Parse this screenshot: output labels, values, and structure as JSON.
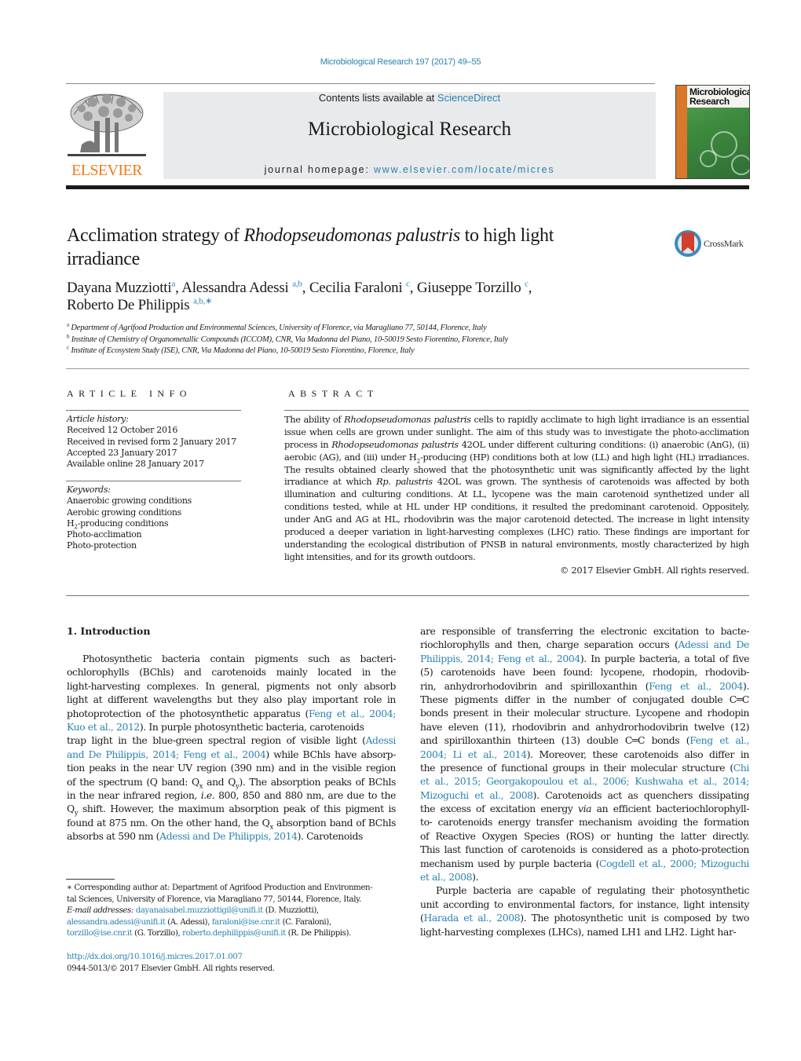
{
  "header": {
    "citation": "Microbiological Research 197 (2017) 49–55",
    "publisher_logo_text": "ELSEVIER",
    "contents_prefix": "Contents lists available at ",
    "contents_link": "ScienceDirect",
    "journal_name": "Microbiological Research",
    "homepage_prefix": "journal homepage: ",
    "homepage_link": "www.elsevier.com/locate/micres",
    "cover_title_line1": "Microbiological",
    "cover_title_line2": "Research",
    "crossmark_label": "CrossMark"
  },
  "colors": {
    "link": "#2a82b0",
    "elsevier_orange": "#f07c1b",
    "masthead_bg": "#e9eaeb"
  },
  "article": {
    "title": [
      [
        {
          "t": "Acclimation strategy of "
        },
        {
          "t": "Rhodopseudomonas palustris",
          "i": true
        },
        {
          "t": " to high light"
        }
      ],
      [
        {
          "t": "irradiance"
        }
      ]
    ],
    "authors": [
      [
        {
          "t": "Dayana Muzziotti"
        },
        {
          "sup": "a"
        },
        {
          "t": ", Alessandra Adessi "
        },
        {
          "sup": "a,b"
        },
        {
          "t": ", Cecilia Faraloni "
        },
        {
          "sup": "c"
        },
        {
          "t": ", Giuseppe Torzillo "
        },
        {
          "sup": "c"
        },
        {
          "t": ","
        }
      ],
      [
        {
          "t": "Roberto De Philippis "
        },
        {
          "sup": "a,b,∗"
        }
      ]
    ],
    "affiliations": [
      [
        {
          "sup": "a"
        },
        {
          "t": " Department of Agrifood Production and Environmental Sciences, University of Florence, via Maragliano 77, 50144, Florence, Italy"
        }
      ],
      [
        {
          "sup": "b"
        },
        {
          "t": " Institute of Chemistry of Organometallic Compounds (ICCOM), CNR, Via Madonna del Piano, 10-50019 Sesto Fiorentino, Florence, Italy"
        }
      ],
      [
        {
          "sup": "c"
        },
        {
          "t": " Institute of Ecosystem Study (ISE), CNR, Via Madonna del Piano, 10-50019 Sesto Fiorentino, Florence, Italy"
        }
      ]
    ]
  },
  "article_info": {
    "heading": "ARTICLE INFO",
    "history_label": "Article history:",
    "history": [
      "Received 12 October 2016",
      "Received in revised form 2 January 2017",
      "Accepted 23 January 2017",
      "Available online 28 January 2017"
    ],
    "keywords_label": "Keywords:",
    "keywords": [
      [
        {
          "t": "Anaerobic growing conditions"
        }
      ],
      [
        {
          "t": "Aerobic growing conditions"
        }
      ],
      [
        {
          "t": "H"
        },
        {
          "sub": "2"
        },
        {
          "t": "-producing conditions"
        }
      ],
      [
        {
          "t": "Photo-acclimation"
        }
      ],
      [
        {
          "t": "Photo-protection"
        }
      ]
    ]
  },
  "abstract": {
    "heading": "ABSTRACT",
    "lines": [
      [
        {
          "t": "The ability of "
        },
        {
          "t": "Rhodopseudomonas palustris",
          "i": true
        },
        {
          "t": " cells to rapidly acclimate to high light irradiance is an essential"
        }
      ],
      [
        {
          "t": "issue when cells are grown under sunlight. The aim of this study was to investigate the photo-acclimation"
        }
      ],
      [
        {
          "t": "process in "
        },
        {
          "t": "Rhodopseudomonas palustris",
          "i": true
        },
        {
          "t": " 42OL under different culturing conditions: (i) anaerobic (AnG), (ii)"
        }
      ],
      [
        {
          "t": "aerobic (AG), and (iii) under H"
        },
        {
          "sub": "2"
        },
        {
          "t": "-producing (HP) conditions both at low (LL) and high light (HL) irradiances."
        }
      ],
      [
        {
          "t": "The results obtained clearly showed that the photosynthetic unit was significantly affected by the light"
        }
      ],
      [
        {
          "t": "irradiance at which "
        },
        {
          "t": "Rp. palustris",
          "i": true
        },
        {
          "t": " 42OL was grown. The synthesis of carotenoids was affected by both"
        }
      ],
      [
        {
          "t": "illumination and culturing conditions. At LL, lycopene was the main carotenoid synthetized under all"
        }
      ],
      [
        {
          "t": "conditions tested, while at HL under HP conditions, it resulted the predominant carotenoid. Oppositely,"
        }
      ],
      [
        {
          "t": "under AnG and AG at HL, rhodovibrin was the major carotenoid detected. The increase in light intensity"
        }
      ],
      [
        {
          "t": "produced a deeper variation in light-harvesting complexes (LHC) ratio. These findings are important for"
        }
      ],
      [
        {
          "t": "understanding the ecological distribution of PNSB in natural environments, mostly characterized by high"
        }
      ],
      [
        {
          "t": "light intensities, and for its growth outdoors."
        }
      ]
    ],
    "copyright": "© 2017 Elsevier GmbH. All rights reserved."
  },
  "body": {
    "section_heading": "1.  Introduction",
    "left_lines": [
      [
        {
          "t": "Photosynthetic bacteria contain pigments such as bacteri-"
        }
      ],
      [
        {
          "t": "ochlorophylls (BChls) and carotenoids mainly located in the"
        }
      ],
      [
        {
          "t": "light-harvesting complexes. In general, pigments not only absorb"
        }
      ],
      [
        {
          "t": "light at different wavelengths but they also play important role in"
        }
      ],
      [
        {
          "t": "photoprotection of the photosynthetic apparatus ("
        },
        {
          "t": "Feng et al., 2004;",
          "l": true
        }
      ],
      [
        {
          "t": "Kuo et al., 2012",
          "l": true
        },
        {
          "t": "). In purple photosynthetic bacteria, carotenoids"
        }
      ],
      [
        {
          "t": "trap light in the blue-green spectral region of visible light ("
        },
        {
          "t": "Adessi",
          "l": true
        }
      ],
      [
        {
          "t": "and De Philippis, 2014; Feng et al., 2004",
          "l": true
        },
        {
          "t": ") while BChls have absorp-"
        }
      ],
      [
        {
          "t": "tion peaks in the near UV region (390 nm) and in the visible region"
        }
      ],
      [
        {
          "t": "of the spectrum (Q band: Q"
        },
        {
          "sub": "x"
        },
        {
          "t": " and Q"
        },
        {
          "sub": "y"
        },
        {
          "t": "). The absorption peaks of BChls"
        }
      ],
      [
        {
          "t": "in the near infrared region, "
        },
        {
          "t": "i.e.",
          "i": true
        },
        {
          "t": " 800, 850 and 880 nm, are due to the"
        }
      ],
      [
        {
          "t": "Q"
        },
        {
          "sub": "y"
        },
        {
          "t": " shift. However, the maximum absorption peak of this pigment is"
        }
      ],
      [
        {
          "t": "found at 875 nm. On the other hand, the Q"
        },
        {
          "sub": "x"
        },
        {
          "t": " absorption band of BChls"
        }
      ],
      [
        {
          "t": "absorbs at 590 nm ("
        },
        {
          "t": "Adessi and De Philippis, 2014",
          "l": true
        },
        {
          "t": "). Carotenoids"
        }
      ]
    ],
    "right_lines": [
      [
        {
          "t": "are responsible of transferring the electronic excitation to bacte-"
        }
      ],
      [
        {
          "t": "riochlorophylls and then, charge separation occurs ("
        },
        {
          "t": "Adessi and De",
          "l": true
        }
      ],
      [
        {
          "t": "Philippis, 2014; Feng et al., 2004",
          "l": true
        },
        {
          "t": "). In purple bacteria, a total of five"
        }
      ],
      [
        {
          "t": "(5) carotenoids have been found: lycopene, rhodopin, rhodovib-"
        }
      ],
      [
        {
          "t": "rin, anhydrorhodovibrin and spirilloxanthin ("
        },
        {
          "t": "Feng et al., 2004",
          "l": true
        },
        {
          "t": ")."
        }
      ],
      [
        {
          "t": "These pigments differ in the number of conjugated double C═C"
        }
      ],
      [
        {
          "t": "bonds present in their molecular structure. Lycopene and rhodopin"
        }
      ],
      [
        {
          "t": "have eleven (11), rhodovibrin and anhydrorhodovibrin twelve (12)"
        }
      ],
      [
        {
          "t": "and spirilloxanthin thirteen (13) double C═C bonds ("
        },
        {
          "t": "Feng et al.,",
          "l": true
        }
      ],
      [
        {
          "t": "2004; Li et al., 2014",
          "l": true
        },
        {
          "t": "). Moreover, these carotenoids also differ in"
        }
      ],
      [
        {
          "t": "the presence of functional groups in their molecular structure ("
        },
        {
          "t": "Chi",
          "l": true
        }
      ],
      [
        {
          "t": "et al., 2015; Georgakopoulou et al., 2006; Kushwaha et al., 2014;",
          "l": true
        }
      ],
      [
        {
          "t": "Mizoguchi et al., 2008",
          "l": true
        },
        {
          "t": "). Carotenoids act as quenchers dissipating"
        }
      ],
      [
        {
          "t": "the excess of excitation energy "
        },
        {
          "t": "via",
          "i": true
        },
        {
          "t": " an efficient bacteriochlorophyll-"
        }
      ],
      [
        {
          "t": "to- carotenoids energy transfer mechanism avoiding the formation"
        }
      ],
      [
        {
          "t": "of Reactive Oxygen Species (ROS) or hunting the latter directly."
        }
      ],
      [
        {
          "t": "This last function of carotenoids is considered as a photo-protection"
        }
      ],
      [
        {
          "t": "mechanism used by purple bacteria ("
        },
        {
          "t": "Cogdell et al., 2000; Mizoguchi",
          "l": true
        }
      ],
      [
        {
          "t": "et al., 2008",
          "l": true
        },
        {
          "t": ")."
        }
      ],
      [
        {
          "t": "Purple bacteria are capable of regulating their photosynthetic",
          "indent": true
        }
      ],
      [
        {
          "t": "unit according to environmental factors, for instance, light intensity"
        }
      ],
      [
        {
          "t": "("
        },
        {
          "t": "Harada et al., 2008",
          "l": true
        },
        {
          "t": "). The photosynthetic unit is composed by two"
        }
      ],
      [
        {
          "t": "light-harvesting complexes (LHCs), named LH1 and LH2. Light har-"
        }
      ]
    ],
    "left_last_lines": [
      5
    ],
    "right_last_lines": [
      18
    ]
  },
  "footnote": {
    "lines": [
      [
        {
          "t": "   ∗  Corresponding author at: Department of Agrifood Production and Environmen-"
        }
      ],
      [
        {
          "t": "tal Sciences, University of Florence, via Maragliano 77, 50144, Florence, Italy."
        }
      ],
      [
        {
          "t": "      "
        },
        {
          "t": "E-mail addresses:",
          "i": true
        },
        {
          "t": " "
        },
        {
          "t": "dayanaisabel.muzziottigil@unifi.it",
          "l": true
        },
        {
          "t": " (D. Muzziotti),"
        }
      ],
      [
        {
          "t": "alessandra.adessi@unifi.it",
          "l": true
        },
        {
          "t": " (A. Adessi), "
        },
        {
          "t": "faraloni@ise.cnr.it",
          "l": true
        },
        {
          "t": " (C. Faraloni),"
        }
      ],
      [
        {
          "t": "torzillo@ise.cnr.it",
          "l": true
        },
        {
          "t": " (G. Torzillo), "
        },
        {
          "t": "roberto.dephilippis@unifi.it",
          "l": true
        },
        {
          "t": " (R. De Philippis)."
        }
      ]
    ],
    "doi": "http://dx.doi.org/10.1016/j.micres.2017.01.007",
    "issn_line": "0944-5013/© 2017 Elsevier GmbH. All rights reserved."
  }
}
